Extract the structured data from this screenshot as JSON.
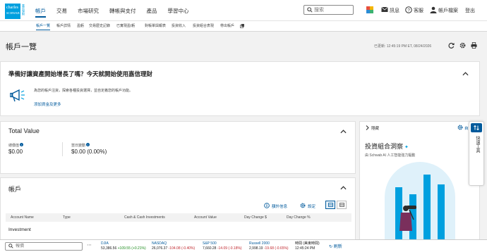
{
  "logo": {
    "line1": "charles",
    "line2": "SCHWAB",
    "sub": "嘉信理財"
  },
  "nav": {
    "items": [
      "帳戶",
      "交易",
      "市場研究",
      "轉帳與支付",
      "產品",
      "學習中心"
    ],
    "active_index": 0
  },
  "search": {
    "placeholder": "搜索"
  },
  "top_right": {
    "messages": "訊息",
    "support": "客服",
    "profile": "帳戶檔案",
    "logout": "登出"
  },
  "subnav": {
    "items": [
      "帳戶一覽",
      "帳戶詳情",
      "盈虧",
      "交易歷史記錄",
      "已實現盈/虧",
      "對帳單與報表",
      "投資收入",
      "投資組合表現",
      "帶出帳戶"
    ]
  },
  "page": {
    "title": "帳戶一覽",
    "updated": "已更新: 12:45:19 PM ET, 08/24/2026"
  },
  "promo": {
    "title": "準備好讓資產開始增長了嗎？今天就開始使用嘉信理財",
    "desc": "為您的帳戶注資，探索各種投資選擇，並自定義您的帳戶功能。",
    "link": "添加資金及更多"
  },
  "total_value": {
    "title": "Total Value",
    "total_label": "總價值",
    "total_value": "$0.00",
    "day_label": "當日變動",
    "day_value": "$0.00 (0.00%)"
  },
  "accounts": {
    "title": "帳戶",
    "extra_info": "額外信息",
    "settings": "設定",
    "columns": [
      "Account Name",
      "Type",
      "Cash & Cash Investments",
      "Account Value",
      "Day Change $",
      "Day Change %"
    ],
    "row_group": "Investment"
  },
  "right_panel": {
    "hide": "隱藏",
    "customize": "自定義",
    "insight_title": "投資組合洞察",
    "insight_sub": "由 Schwab AI 人工智能強力驅動",
    "side_tab": "快速工具"
  },
  "ticker": {
    "search_placeholder": "報價",
    "items": [
      {
        "name": "DJIA",
        "value": "53,386.56",
        "change": "+109.55 (+0.21%)",
        "dir": "up"
      },
      {
        "name": "NASDAQ",
        "value": "26,076.37",
        "change": "-104.08 (-0.40%)",
        "dir": "down"
      },
      {
        "name": "S&P 500",
        "value": "7,660.28",
        "change": "-14.09 (-0.18%)",
        "dir": "down"
      },
      {
        "name": "Russell 2000",
        "value": "2,998.19",
        "change": "-19.68 (-0.65%)",
        "dir": "down"
      }
    ],
    "time_label": "時間 (美東時間)",
    "time_value": "12:45:24 PM",
    "refresh": "刷新"
  },
  "colors": {
    "brand": "#00a0df",
    "link": "#005a9c",
    "positive": "#1a8a1a",
    "negative": "#c0282e"
  }
}
